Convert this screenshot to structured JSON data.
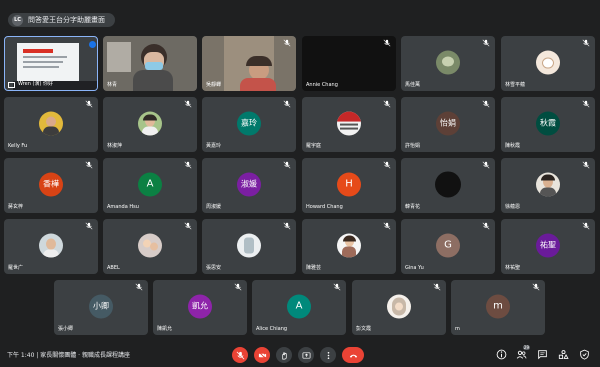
{
  "meeting": {
    "org_badge": "LC",
    "title": "問答愛王台分字助麗畫面"
  },
  "tiles": [
    {
      "name": "Wren (演) 你好",
      "type": "screen"
    },
    {
      "name": "林青",
      "type": "video"
    },
    {
      "name": "吳靜蟬",
      "type": "video"
    },
    {
      "name": "Annie Chang",
      "type": "blank"
    },
    {
      "name": "馬佳萬",
      "type": "photo"
    },
    {
      "name": "林雪平蘊",
      "type": "photo"
    },
    {
      "name": "Kelly Fu",
      "type": "photo"
    },
    {
      "name": "林淑萍",
      "type": "photo"
    },
    {
      "name": "黃嘉玲",
      "type": "initials",
      "initials": "嘉玲",
      "color": "#00796b"
    },
    {
      "name": "羅宇庭",
      "type": "photo"
    },
    {
      "name": "許怡娟",
      "type": "initials",
      "initials": "怡娟",
      "color": "#5d4037"
    },
    {
      "name": "陳秋霞",
      "type": "initials",
      "initials": "秋霞",
      "color": "#004d40"
    },
    {
      "name": "蔣玄梓",
      "type": "initials",
      "initials": "香樺",
      "color": "#d84315"
    },
    {
      "name": "Amanda Hsu",
      "type": "initials",
      "initials": "A",
      "color": "#0b8043"
    },
    {
      "name": "周淑媛",
      "type": "initials",
      "initials": "淑媛",
      "color": "#7b1fa2"
    },
    {
      "name": "Howard Chang",
      "type": "initials",
      "initials": "H",
      "color": "#e64a19"
    },
    {
      "name": "韓青花",
      "type": "initials",
      "initials": "",
      "color": "#111111"
    },
    {
      "name": "徐蘊恩",
      "type": "photo"
    },
    {
      "name": "羅世广",
      "type": "photo"
    },
    {
      "name": "ABEL",
      "type": "photo"
    },
    {
      "name": "張思安",
      "type": "photo"
    },
    {
      "name": "陳雅芸",
      "type": "photo"
    },
    {
      "name": "Gina Yu",
      "type": "initials",
      "initials": "G",
      "color": "#8d6e63"
    },
    {
      "name": "林祐聖",
      "type": "initials",
      "initials": "祐聖",
      "color": "#6a1b9a"
    },
    {
      "name": "張小卿",
      "type": "initials",
      "initials": "小卿",
      "color": "#455a64"
    },
    {
      "name": "陳凱允",
      "type": "initials",
      "initials": "凱允",
      "color": "#8e24aa"
    },
    {
      "name": "Alice Chiang",
      "type": "initials",
      "initials": "A",
      "color": "#00897b"
    },
    {
      "name": "彭文霞",
      "type": "photo"
    },
    {
      "name": "m",
      "type": "initials",
      "initials": "m",
      "color": "#6d4c41"
    }
  ],
  "bottombar": {
    "clock": "下午 1:40 | 家長關懷團體 ‧ 親職成長課程講座",
    "participant_count": "29"
  },
  "icons": {
    "mic": "mic-off-icon",
    "camera": "camera-off-icon",
    "hand": "raise-hand-icon",
    "present": "present-icon",
    "more": "more-options-icon",
    "end": "end-call-icon",
    "info": "info-icon",
    "people": "people-icon",
    "chat": "chat-icon",
    "activities": "activities-icon",
    "safety": "host-controls-icon"
  },
  "colors": {
    "background": "#1f2021",
    "tile": "#3c4043",
    "danger": "#ea4335"
  }
}
